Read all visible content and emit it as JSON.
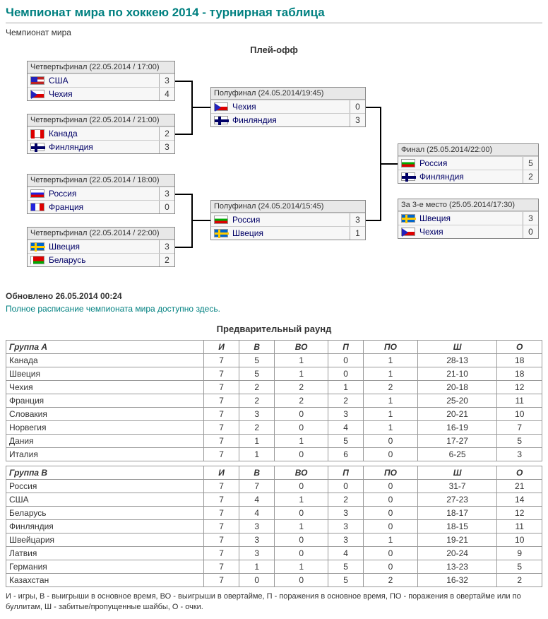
{
  "title": "Чемпионат мира по хоккею 2014 - турнирная таблица",
  "subtitle": "Чемпионат мира",
  "playoff_heading": "Плей-офф",
  "updated": "Обновлено 26.05.2014 00:24",
  "schedule_link": "Полное расписание чемпионата мира доступно здесь.",
  "prelim_heading": "Предварительный раунд",
  "legend": "И - игры, В - выигрыши в основное время, ВО - выигрыши в овертайме, П - поражения в основное время, ПО - поражения в овертайме или по буллитам, Ш - забитые/пропущенные шайбы, О - очки.",
  "qf": [
    {
      "title": "Четвертьфинал (22.05.2014 / 17:00)",
      "t1": "США",
      "s1": "3",
      "f1": "usa",
      "t2": "Чехия",
      "s2": "4",
      "f2": "cze"
    },
    {
      "title": "Четвертьфинал (22.05.2014 / 21:00)",
      "t1": "Канада",
      "s1": "2",
      "f1": "can",
      "t2": "Финляндия",
      "s2": "3",
      "f2": "fin"
    },
    {
      "title": "Четвертьфинал (22.05.2014 / 18:00)",
      "t1": "Россия",
      "s1": "3",
      "f1": "rus",
      "t2": "Франция",
      "s2": "0",
      "f2": "fra"
    },
    {
      "title": "Четвертьфинал (22.05.2014 / 22:00)",
      "t1": "Швеция",
      "s1": "3",
      "f1": "swe",
      "t2": "Беларусь",
      "s2": "2",
      "f2": "blr"
    }
  ],
  "sf": [
    {
      "title": "Полуфинал (24.05.2014/19:45)",
      "t1": "Чехия",
      "s1": "0",
      "f1": "cze",
      "t2": "Финляндия",
      "s2": "3",
      "f2": "fin"
    },
    {
      "title": "Полуфинал (24.05.2014/15:45)",
      "t1": "Россия",
      "s1": "3",
      "f1": "bgr",
      "t2": "Швеция",
      "s2": "1",
      "f2": "swe"
    }
  ],
  "final": {
    "title": "Финал (25.05.2014/22:00)",
    "t1": "Россия",
    "s1": "5",
    "f1": "bgr",
    "t2": "Финляндия",
    "s2": "2",
    "f2": "fin"
  },
  "third": {
    "title": "За 3-е место (25.05.2014/17:30)",
    "t1": "Швеция",
    "s1": "3",
    "f1": "swe",
    "t2": "Чехия",
    "s2": "0",
    "f2": "cze"
  },
  "cols": {
    "team": "",
    "i": "И",
    "v": "В",
    "vo": "ВО",
    "p": "П",
    "po": "ПО",
    "sh": "Ш",
    "o": "О"
  },
  "groupA": {
    "name": "Группа A",
    "rows": [
      [
        "Канада",
        "7",
        "5",
        "1",
        "0",
        "1",
        "28-13",
        "18"
      ],
      [
        "Швеция",
        "7",
        "5",
        "1",
        "0",
        "1",
        "21-10",
        "18"
      ],
      [
        "Чехия",
        "7",
        "2",
        "2",
        "1",
        "2",
        "20-18",
        "12"
      ],
      [
        "Франция",
        "7",
        "2",
        "2",
        "2",
        "1",
        "25-20",
        "11"
      ],
      [
        "Словакия",
        "7",
        "3",
        "0",
        "3",
        "1",
        "20-21",
        "10"
      ],
      [
        "Норвегия",
        "7",
        "2",
        "0",
        "4",
        "1",
        "16-19",
        "7"
      ],
      [
        "Дания",
        "7",
        "1",
        "1",
        "5",
        "0",
        "17-27",
        "5"
      ],
      [
        "Италия",
        "7",
        "1",
        "0",
        "6",
        "0",
        "6-25",
        "3"
      ]
    ]
  },
  "groupB": {
    "name": "Группа B",
    "rows": [
      [
        "Россия",
        "7",
        "7",
        "0",
        "0",
        "0",
        "31-7",
        "21"
      ],
      [
        "США",
        "7",
        "4",
        "1",
        "2",
        "0",
        "27-23",
        "14"
      ],
      [
        "Беларусь",
        "7",
        "4",
        "0",
        "3",
        "0",
        "18-17",
        "12"
      ],
      [
        "Финляндия",
        "7",
        "3",
        "1",
        "3",
        "0",
        "18-15",
        "11"
      ],
      [
        "Швейцария",
        "7",
        "3",
        "0",
        "3",
        "1",
        "19-21",
        "10"
      ],
      [
        "Латвия",
        "7",
        "3",
        "0",
        "4",
        "0",
        "20-24",
        "9"
      ],
      [
        "Германия",
        "7",
        "1",
        "1",
        "5",
        "0",
        "13-23",
        "5"
      ],
      [
        "Казахстан",
        "7",
        "0",
        "0",
        "5",
        "2",
        "16-32",
        "2"
      ]
    ]
  }
}
